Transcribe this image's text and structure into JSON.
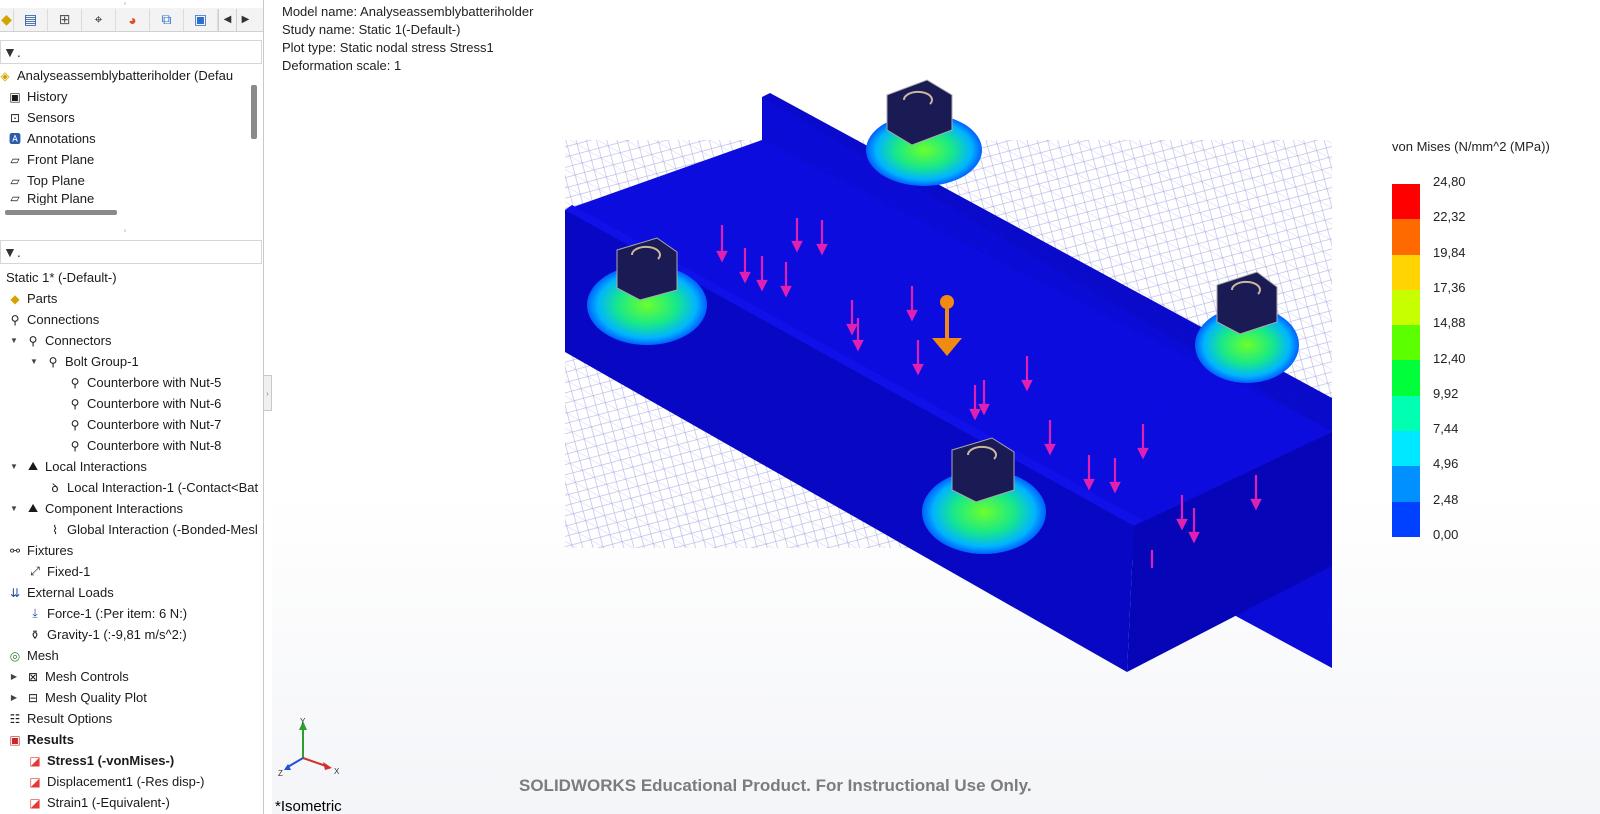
{
  "viewport_info": {
    "model_name": "Model name: Analyseassemblybatteriholder",
    "study_name": "Study name: Static 1(-Default-)",
    "plot_type": "Plot type: Static nodal stress Stress1",
    "deformation_scale": "Deformation scale: 1"
  },
  "legend": {
    "title": "von Mises (N/mm^2 (MPa))",
    "labels": [
      "24,80",
      "22,32",
      "19,84",
      "17,36",
      "14,88",
      "12,40",
      "9,92",
      "7,44",
      "4,96",
      "2,48",
      "0,00"
    ],
    "colors": [
      "#ff0000",
      "#ff6a00",
      "#ffd400",
      "#c8ff00",
      "#5cff00",
      "#00ff3a",
      "#00ffb0",
      "#00e8ff",
      "#0090ff",
      "#0040ff",
      "#0000ff"
    ]
  },
  "watermark": "SOLIDWORKS Educational Product. For Instructional Use Only.",
  "view_name": "*Isometric",
  "triad": {
    "x": "X",
    "y": "Y",
    "z": "Z"
  },
  "feature_tree": {
    "filter_text": "▼.",
    "root": "Analyseassemblybatteriholder (Defau",
    "items": [
      "History",
      "Sensors",
      "Annotations",
      "Front Plane",
      "Top Plane",
      "Right Plane"
    ]
  },
  "study_tree": {
    "filter_text": "▼.",
    "study": "Static 1* (-Default-)",
    "parts": "Parts",
    "connections": "Connections",
    "connectors": "Connectors",
    "bolt_group": "Bolt Group-1",
    "bolts": [
      "Counterbore with Nut-5",
      "Counterbore with Nut-6",
      "Counterbore with Nut-7",
      "Counterbore with Nut-8"
    ],
    "local_interactions": "Local Interactions",
    "local_interaction_1": "Local Interaction-1 (-Contact<Bat",
    "component_interactions": "Component Interactions",
    "global_interaction": "Global Interaction (-Bonded-Mesl",
    "fixtures": "Fixtures",
    "fixed_1": "Fixed-1",
    "external_loads": "External Loads",
    "force_1": "Force-1 (:Per item: 6 N:)",
    "gravity_1": "Gravity-1 (:-9,81 m/s^2:)",
    "mesh": "Mesh",
    "mesh_controls": "Mesh Controls",
    "mesh_quality_plot": "Mesh Quality Plot",
    "result_options": "Result Options",
    "results": "Results",
    "stress1": "Stress1 (-vonMises-)",
    "displacement1": "Displacement1 (-Res disp-)",
    "strain1": "Strain1 (-Equivalent-)"
  }
}
